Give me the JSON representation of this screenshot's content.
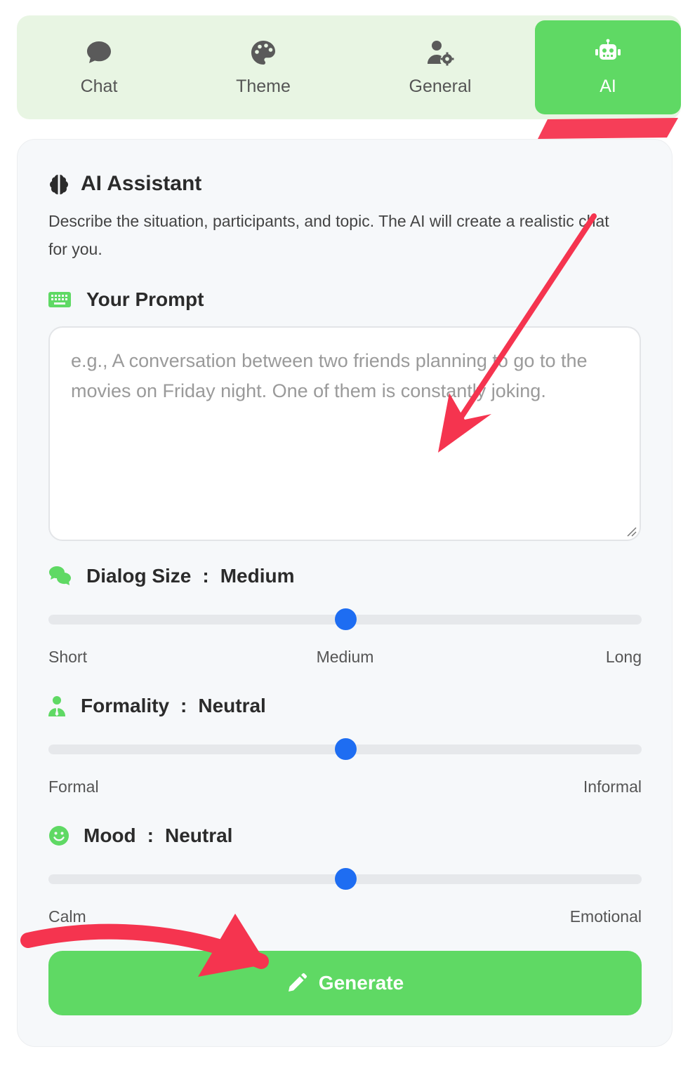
{
  "tabs": [
    {
      "label": "Chat",
      "icon": "chat-bubble-icon",
      "active": false
    },
    {
      "label": "Theme",
      "icon": "palette-icon",
      "active": false
    },
    {
      "label": "General",
      "icon": "user-gear-icon",
      "active": false
    },
    {
      "label": "AI",
      "icon": "robot-icon",
      "active": true
    }
  ],
  "assistant": {
    "title": "AI Assistant",
    "description": "Describe the situation, participants, and topic. The AI will create a realistic chat for you."
  },
  "prompt": {
    "label": "Your Prompt",
    "placeholder": "e.g., A conversation between two friends planning to go to the movies on Friday night. One of them is constantly joking.",
    "value": ""
  },
  "sliders": {
    "dialog_size": {
      "label": "Dialog Size",
      "value_label": "Medium",
      "ticks": [
        "Short",
        "Medium",
        "Long"
      ],
      "position": 0.5
    },
    "formality": {
      "label": "Formality",
      "value_label": "Neutral",
      "ticks": [
        "Formal",
        "Informal"
      ],
      "position": 0.5
    },
    "mood": {
      "label": "Mood",
      "value_label": "Neutral",
      "ticks": [
        "Calm",
        "Emotional"
      ],
      "position": 0.5
    }
  },
  "separator": ":",
  "generate": {
    "label": "Generate"
  },
  "colors": {
    "accent": "#5fd964",
    "slider_thumb": "#1e6df2",
    "annotation": "#f5344f"
  }
}
